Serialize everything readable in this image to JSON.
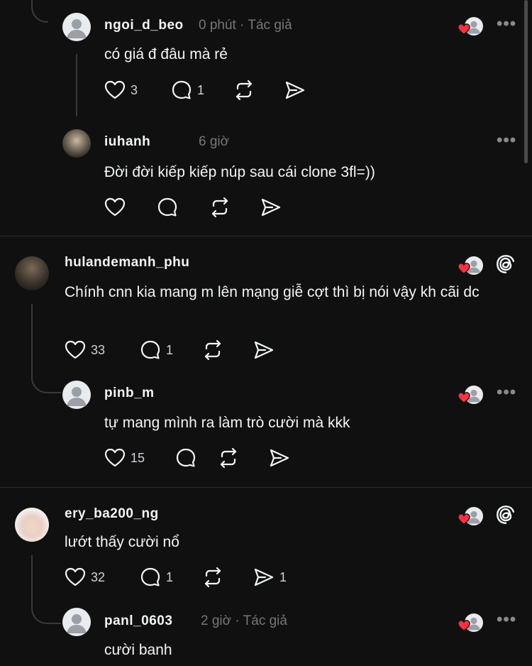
{
  "comments": [
    {
      "username": "ngoi_d_beo",
      "time": "0 phút",
      "author_label": "Tác giả",
      "text": "có giá đ đâu mà rẻ",
      "likes": "3",
      "replies": "1",
      "reposts": "",
      "shares": ""
    },
    {
      "username": "iuhanh",
      "time": "6 giờ",
      "author_label": "",
      "text": "Đời đời kiếp kiếp núp sau cái clone 3fl=))",
      "likes": "",
      "replies": "",
      "reposts": "",
      "shares": ""
    },
    {
      "username": "hulandemanh_phu",
      "time": "",
      "author_label": "",
      "text": "Chính cnn kia mang m lên mạng giễ cợt thì bị nói vậy kh cãi dc",
      "likes": "33",
      "replies": "1",
      "reposts": "",
      "shares": ""
    },
    {
      "username": "pinb_m",
      "time": "",
      "author_label": "",
      "text": "tự mang mình ra làm trò cười mà kkk",
      "likes": "15",
      "replies": "",
      "reposts": "",
      "shares": ""
    },
    {
      "username": "ery_ba200_ng",
      "time": "",
      "author_label": "",
      "text": "lướt thấy cười nổ",
      "likes": "32",
      "replies": "1",
      "reposts": "",
      "shares": "1"
    },
    {
      "username": "panl_0603",
      "time": "2 giờ",
      "author_label": "Tác giả",
      "text": "cười banh",
      "likes": "",
      "replies": "",
      "reposts": "",
      "shares": ""
    }
  ],
  "icons": {
    "like": "heart-icon",
    "reply": "comment-icon",
    "repost": "repost-icon",
    "share": "send-icon",
    "more": "more-icon",
    "threads": "threads-logo-icon"
  },
  "colors": {
    "background": "#101010",
    "text": "#f3f5f7",
    "muted": "#777777",
    "heart": "#ff3040"
  }
}
